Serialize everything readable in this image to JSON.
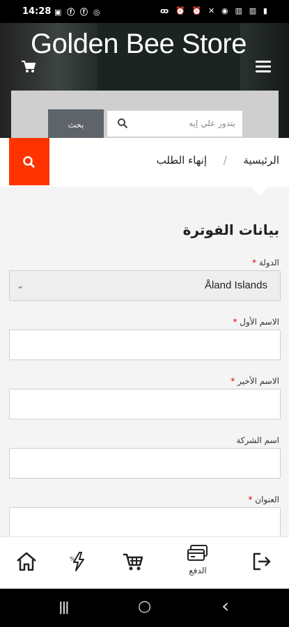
{
  "status_bar": {
    "time": "14:28",
    "left_icons": "▣ ⓕ ⓕ ◎",
    "right_icons": "ꝏ ⏰ ⏰ ✕ ◉ ▥ ▥ ▮"
  },
  "header": {
    "brand": "Golden Bee Store",
    "search": {
      "button_label": "بحث",
      "placeholder": "بتدور علي إيه"
    }
  },
  "breadcrumb": {
    "home": "الرئيسية",
    "separator": "/",
    "current": "إنهاء الطلب"
  },
  "form": {
    "title": "بيانات الفوترة",
    "fields": [
      {
        "label": "الدولة",
        "required": "*",
        "value": "Åland Islands"
      },
      {
        "label": "الاسم الأول",
        "required": "*",
        "value": ""
      },
      {
        "label": "الاسم الأخير",
        "required": "*",
        "value": ""
      },
      {
        "label": "اسم الشركة",
        "required": "",
        "value": ""
      },
      {
        "label": "العنوان",
        "required": "*",
        "value": ""
      }
    ]
  },
  "bottom_nav": {
    "items": [
      {
        "icon": "home-icon",
        "label": ""
      },
      {
        "icon": "flash-sale-icon",
        "label": ""
      },
      {
        "icon": "cart-icon",
        "label": ""
      },
      {
        "icon": "payment-icon",
        "label": "الدفع"
      },
      {
        "icon": "logout-icon",
        "label": ""
      }
    ]
  },
  "android_nav": {
    "recents": "|||",
    "home": "○",
    "back": "‹"
  },
  "colors": {
    "accent": "#ff3300",
    "header_bg": "#1c2422",
    "search_button": "#5e6469",
    "required": "#dd0000"
  }
}
